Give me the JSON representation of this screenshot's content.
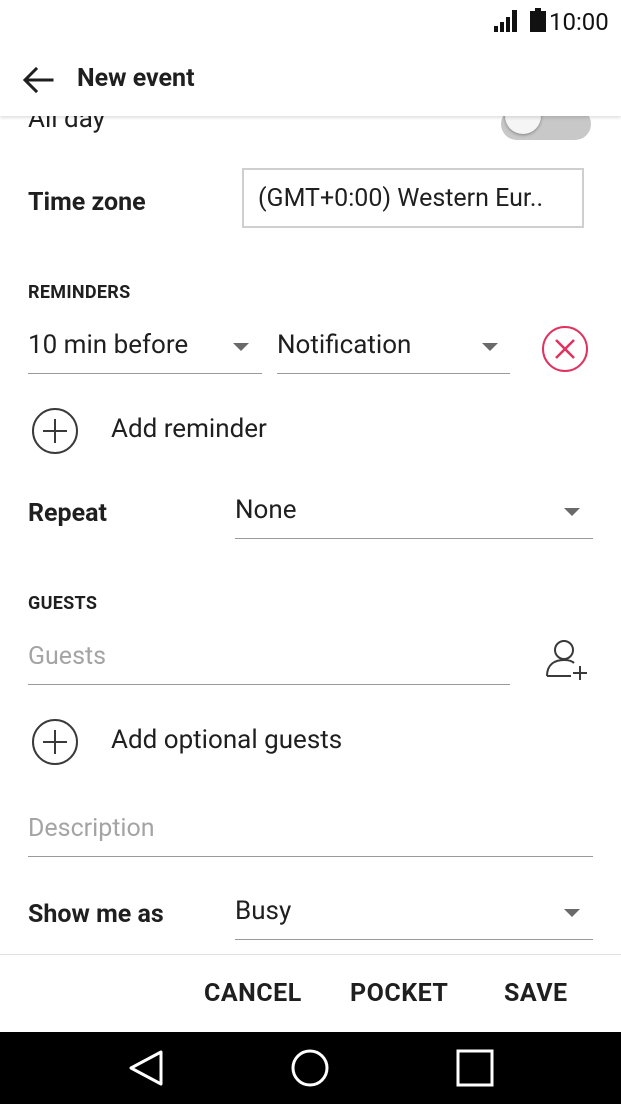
{
  "status_bar": {
    "time": "10:00"
  },
  "app_bar": {
    "title": "New event"
  },
  "all_day": {
    "label": "All day",
    "on": false
  },
  "time_zone": {
    "label": "Time zone",
    "value": "(GMT+0:00) Western Eur.."
  },
  "reminders": {
    "section_label": "REMINDERS",
    "time_value": "10 min before",
    "type_value": "Notification",
    "add_label": "Add reminder"
  },
  "repeat": {
    "label": "Repeat",
    "value": "None"
  },
  "guests": {
    "section_label": "GUESTS",
    "placeholder": "Guests",
    "add_optional_label": "Add optional guests"
  },
  "description": {
    "placeholder": "Description"
  },
  "show_me_as": {
    "label": "Show me as",
    "value": "Busy"
  },
  "actions": {
    "cancel": "CANCEL",
    "pocket": "POCKET",
    "save": "SAVE"
  },
  "colors": {
    "accent": "#e0325f",
    "toggle_track": "#c8c8c8"
  }
}
